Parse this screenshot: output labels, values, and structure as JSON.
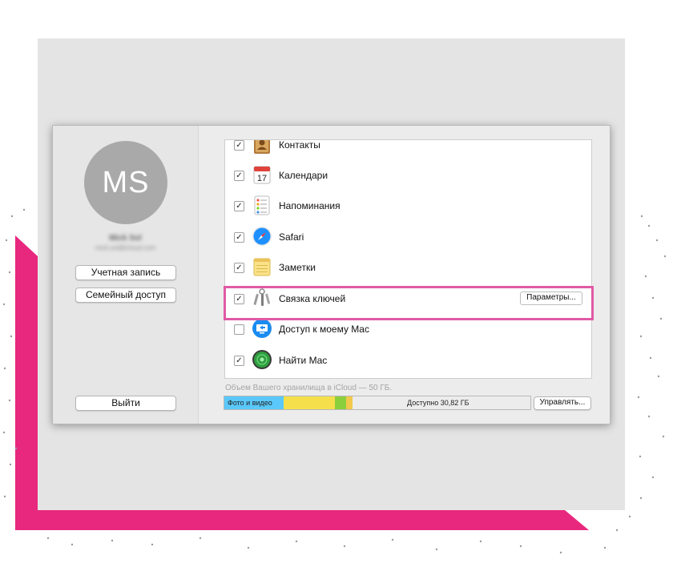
{
  "account": {
    "avatar_initials": "MS",
    "user_name": "Mick Sol",
    "user_email": "mick.sol@icloud.com",
    "account_button": "Учетная запись",
    "family_button": "Семейный доступ",
    "logout_button": "Выйти"
  },
  "services": [
    {
      "label": "Контакты",
      "checked": true,
      "icon": "contacts-icon"
    },
    {
      "label": "Календари",
      "checked": true,
      "icon": "calendar-icon",
      "icon_text": "17"
    },
    {
      "label": "Напоминания",
      "checked": true,
      "icon": "reminders-icon"
    },
    {
      "label": "Safari",
      "checked": true,
      "icon": "safari-icon"
    },
    {
      "label": "Заметки",
      "checked": true,
      "icon": "notes-icon"
    },
    {
      "label": "Связка ключей",
      "checked": true,
      "icon": "keychain-icon",
      "button": "Параметры..."
    },
    {
      "label": "Доступ к моему Mac",
      "checked": false,
      "icon": "back-to-my-mac-icon"
    },
    {
      "label": "Найти Mac",
      "checked": true,
      "icon": "find-my-mac-icon"
    }
  ],
  "storage": {
    "summary": "Объем Вашего хранилища в iCloud — 50 ГБ.",
    "photos_label": "Фото и видео",
    "available_label": "Доступно 30,82 ГБ",
    "manage_button": "Управлять...",
    "colors": {
      "photos": "#5ac8fa",
      "docs": "#f5e04c",
      "mail": "#f2c94c",
      "backup": "#8ccf3c",
      "other": "#f0a830"
    }
  },
  "check_glyph": "✓"
}
